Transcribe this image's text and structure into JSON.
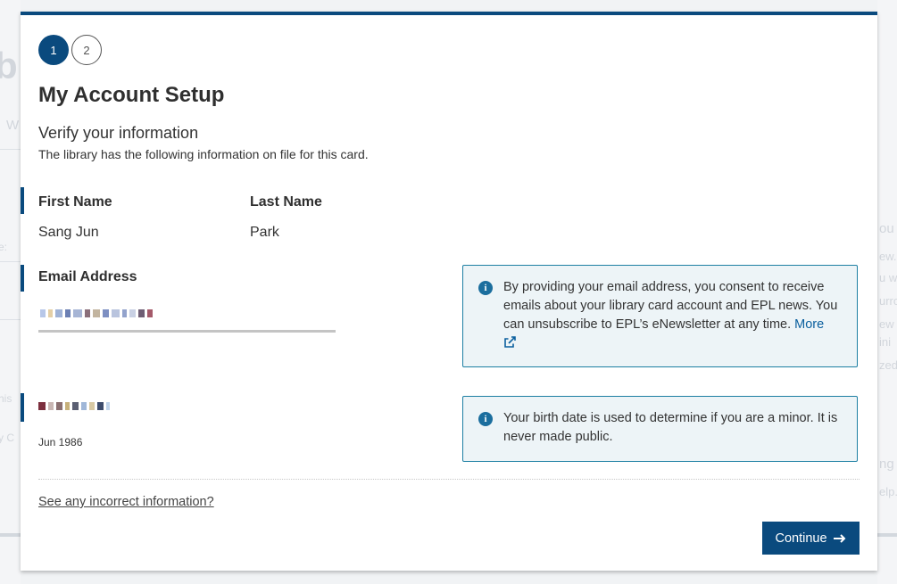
{
  "stepper": {
    "steps": [
      "1",
      "2"
    ],
    "active_index": 0
  },
  "header": {
    "title": "My Account Setup",
    "subtitle": "Verify your information",
    "description": "The library has the following information on file for this card."
  },
  "fields": {
    "first_name": {
      "label": "First Name",
      "value": "Sang Jun"
    },
    "last_name": {
      "label": "Last Name",
      "value": "Park"
    },
    "email": {
      "label": "Email Address"
    },
    "birth_date": {
      "value_visible": "Jun 1986"
    }
  },
  "info": {
    "email_notice": "By providing your email address, you consent to receive emails about your library card account and EPL news. You can unsubscribe to EPL’s eNewsletter at any time.",
    "email_more_link": "More",
    "birth_notice": "Your birth date is used to determine if you are a minor. It is never made public."
  },
  "links": {
    "incorrect_info": "See any incorrect information?"
  },
  "actions": {
    "continue_label": "Continue"
  },
  "colors": {
    "primary": "#0a4a7e",
    "info_border": "#1d7fa3",
    "info_bg": "#edf4f7"
  },
  "icons": [
    "info-icon",
    "external-link-icon",
    "arrow-right-icon"
  ]
}
